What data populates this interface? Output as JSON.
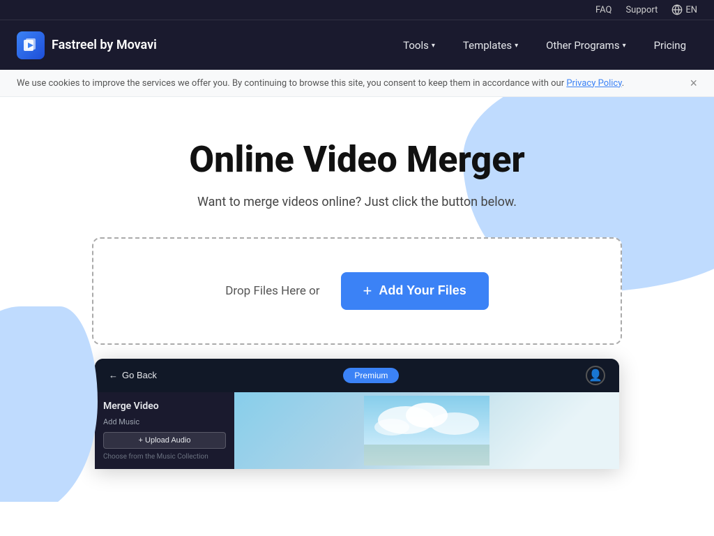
{
  "topbar": {
    "faq_label": "FAQ",
    "support_label": "Support",
    "lang_label": "EN"
  },
  "navbar": {
    "logo_text": "Fastreel by Movavi",
    "tools_label": "Tools",
    "templates_label": "Templates",
    "other_programs_label": "Other Programs",
    "pricing_label": "Pricing"
  },
  "cookie_banner": {
    "text": "We use cookies to improve the services we offer you. By continuing to browse this site, you consent to keep them in accordance with our",
    "link_text": "Privacy Policy",
    "close_label": "×"
  },
  "hero": {
    "title": "Online Video Merger",
    "subtitle": "Want to merge videos online? Just click the button below.",
    "drop_text": "Drop Files Here or",
    "add_files_label": "Add Your Files"
  },
  "preview": {
    "back_label": "Go Back",
    "premium_label": "Premium",
    "title": "Merge Video",
    "add_music_label": "Add Music",
    "upload_audio_label": "+ Upload Audio",
    "collection_label": "Choose from the Music Collection"
  },
  "colors": {
    "accent": "#3b82f6",
    "dark_bg": "#1a1a2e",
    "blob": "#bfdbfe"
  }
}
